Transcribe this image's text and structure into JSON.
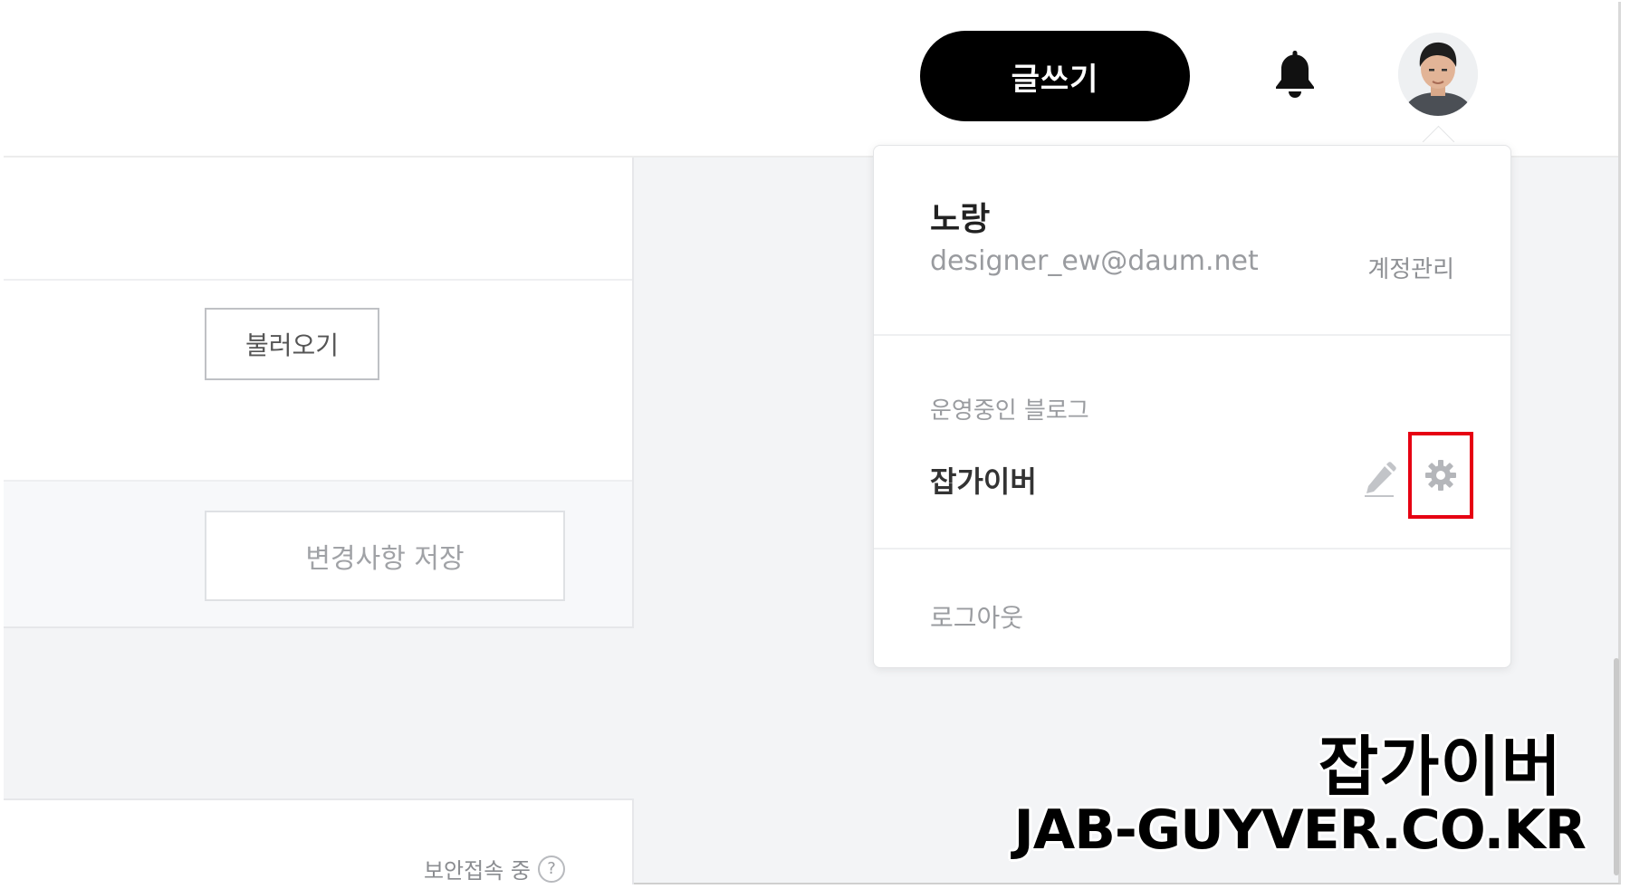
{
  "header": {
    "write_label": "글쓰기",
    "bell_icon": "bell-icon",
    "avatar_icon": "user-avatar"
  },
  "left_panel": {
    "load_button_label": "불러오기",
    "save_button_label": "변경사항 저장",
    "secure_label": "보안접속 중",
    "secure_help_glyph": "?"
  },
  "account_menu": {
    "name": "노랑",
    "email": "designer_ew@daum.net",
    "manage_account_label": "계정관리",
    "blogs_heading": "운영중인 블로그",
    "blog_name": "잡가이버",
    "edit_icon": "pencil-icon",
    "settings_icon": "gear-icon",
    "highlight_color": "#e60012",
    "logout_label": "로그아웃"
  },
  "watermark": {
    "korean": "잡가이버",
    "domain": "JAB-GUYVER.CO.KR"
  }
}
